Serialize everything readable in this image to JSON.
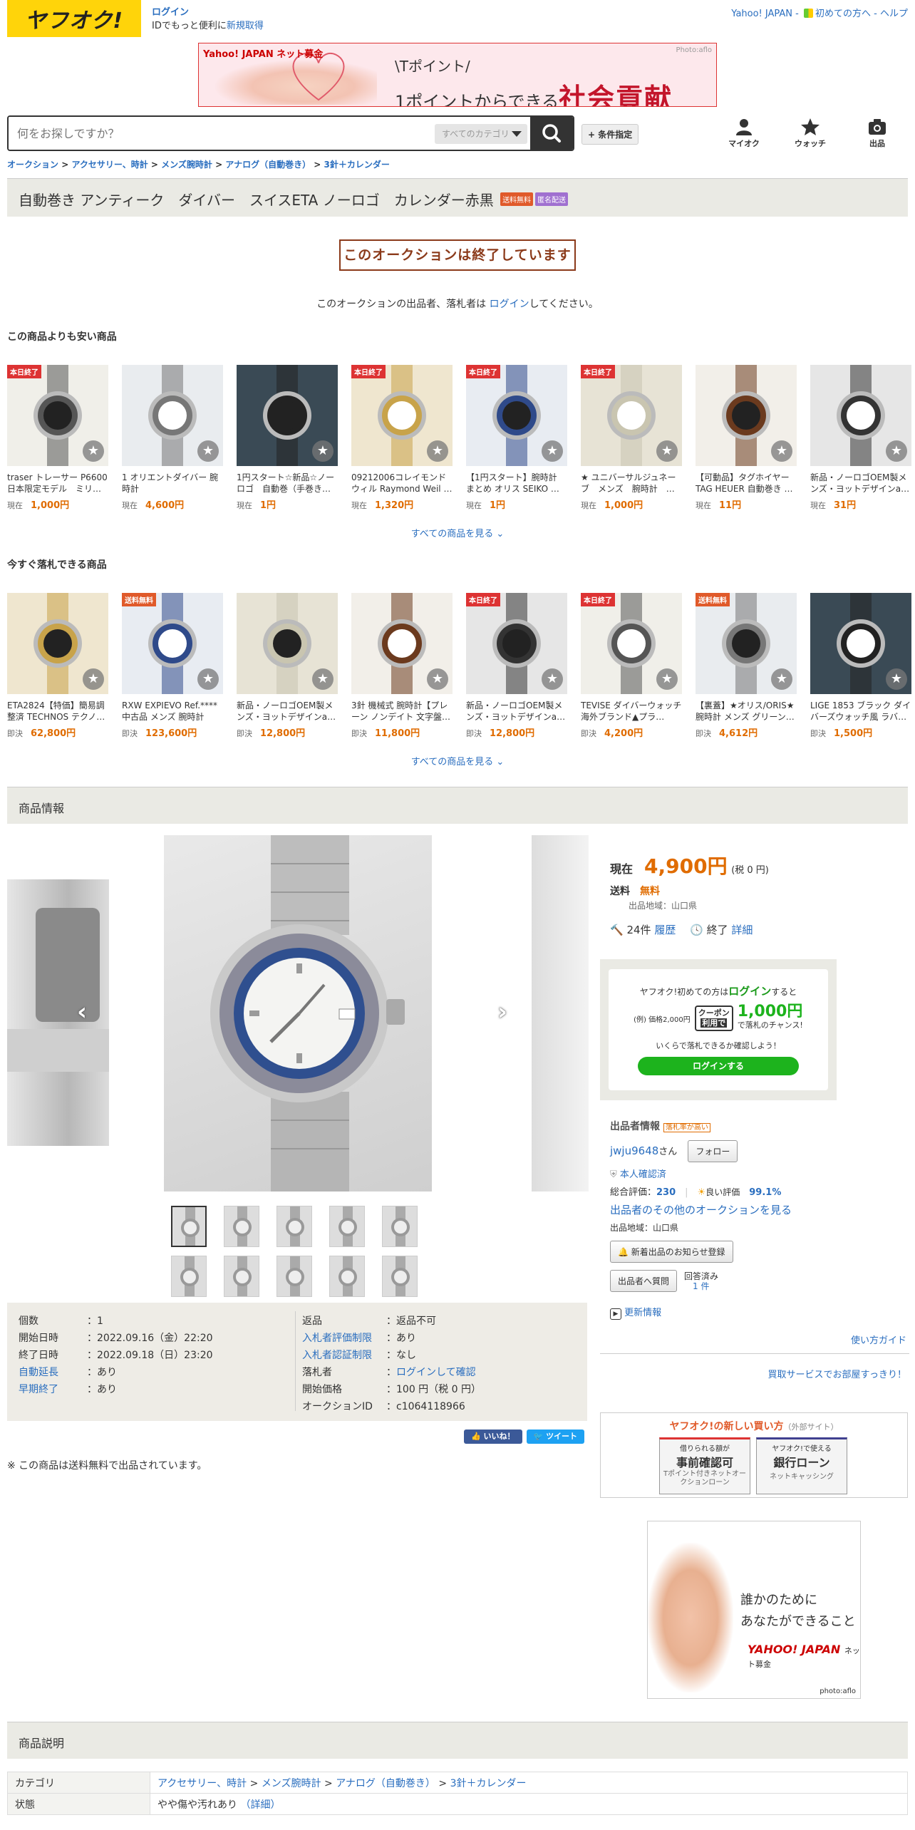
{
  "header": {
    "logo": "ヤフオク!",
    "login": "ログイン",
    "login_sub_prefix": "IDでもっと便利に",
    "signup": "新規取得",
    "yahoo_japan": "Yahoo! JAPAN",
    "beginners": "初めての方へ",
    "help": "ヘルプ",
    "sep1": " - ",
    "sep2": " - "
  },
  "banner": {
    "brand": "Yahoo! JAPAN ネット募金",
    "photo": "Photo:aflo",
    "line1": "\\Tポイント/",
    "line2": "1ポイントからできる",
    "line3": "社会貢献"
  },
  "search": {
    "placeholder": "何をお探しですか？",
    "category": "すべてのカテゴリ",
    "condition": "+ 条件指定"
  },
  "nav": {
    "mypage": "マイオク",
    "watch": "ウォッチ",
    "sell": "出品"
  },
  "breadcrumb": [
    "オークション",
    "アクセサリー、時計",
    "メンズ腕時計",
    "アナログ（自動巻き）",
    "3針＋カレンダー"
  ],
  "breadcrumb_sep": " > ",
  "title": "自動巻き アンティーク　ダイバー　スイスETA ノーロゴ　カレンダー赤黒",
  "badges": {
    "free_ship": "送料無料",
    "anonymous": "匿名配送"
  },
  "ended": {
    "message": "このオークションは終了しています",
    "note_pre": "このオークションの出品者、落札者は ",
    "note_link": "ログイン",
    "note_post": "してください。"
  },
  "cheaper": {
    "heading": "この商品よりも安い商品",
    "see_all": "すべての商品を見る",
    "items": [
      {
        "title": "traser トレーサー P6600 日本限定モデル　ミリ…",
        "label": "現在",
        "price": "1,000円",
        "ribbon": "本日終了"
      },
      {
        "title": "1 オリエントダイバー 腕時計",
        "label": "現在",
        "price": "4,600円",
        "ribbon": ""
      },
      {
        "title": "1円スタート☆新品☆ノーロゴ　自動巻（手巻き…",
        "label": "現在",
        "price": "1円",
        "ribbon": ""
      },
      {
        "title": "09212006コレイモンドウィル Raymond Weil …",
        "label": "現在",
        "price": "1,320円",
        "ribbon": "本日終了"
      },
      {
        "title": "【1円スタート】腕時計 まとめ オリス SEIKO …",
        "label": "現在",
        "price": "1円",
        "ribbon": "本日終了"
      },
      {
        "title": "★ ユニバーサルジュネーブ　メンズ　腕時計　…",
        "label": "現在",
        "price": "1,000円",
        "ribbon": "本日終了"
      },
      {
        "title": "【可動品】タグホイヤー TAG HEUER 自動巻き …",
        "label": "現在",
        "price": "11円",
        "ribbon": ""
      },
      {
        "title": "新品・ノーロゴOEM製メンズ・ヨットデザインa…",
        "label": "現在",
        "price": "31円",
        "ribbon": ""
      }
    ]
  },
  "buynow": {
    "heading": "今すぐ落札できる商品",
    "see_all": "すべての商品を見る",
    "items": [
      {
        "title": "ETA2824【特価】簡易調整済 TECHNOS テクノ…",
        "label": "即決",
        "price": "62,800円",
        "ribbon": ""
      },
      {
        "title": "RXW EXPIEVO Ref.**** 中古品 メンズ 腕時計",
        "label": "即決",
        "price": "123,600円",
        "ribbon": "送料無料"
      },
      {
        "title": "新品・ノーロゴOEM製メンズ・ヨットデザインa…",
        "label": "即決",
        "price": "12,800円",
        "ribbon": ""
      },
      {
        "title": "3針 機械式 腕時計【プレーン ノンデイト 文字盤…",
        "label": "即決",
        "price": "11,800円",
        "ribbon": ""
      },
      {
        "title": "新品・ノーロゴOEM製メンズ・ヨットデザインa…",
        "label": "即決",
        "price": "12,800円",
        "ribbon": "本日終了"
      },
      {
        "title": "TEVISE ダイバーウォッチ 海外ブランド▲プラ…",
        "label": "即決",
        "price": "4,200円",
        "ribbon": "本日終了"
      },
      {
        "title": "【裏蓋】★オリス/ORIS★腕時計 メンズ グリーン…",
        "label": "即決",
        "price": "4,612円",
        "ribbon": "送料無料"
      },
      {
        "title": "LIGE 1853 ブラック ダイバーズウォッチ風 ラバ…",
        "label": "即決",
        "price": "1,500円",
        "ribbon": ""
      }
    ]
  },
  "product_info": {
    "heading": "商品情報"
  },
  "specs": {
    "left": [
      {
        "k": "個数",
        "v": "1",
        "link": false
      },
      {
        "k": "開始日時",
        "v": "2022.09.16（金）22:20",
        "link": false
      },
      {
        "k": "終了日時",
        "v": "2022.09.18（日）23:20",
        "link": false
      },
      {
        "k": "自動延長",
        "v": "あり",
        "link": true
      },
      {
        "k": "早期終了",
        "v": "あり",
        "link": true
      }
    ],
    "right": [
      {
        "k": "返品",
        "v": "返品不可",
        "link": false
      },
      {
        "k": "入札者評価制限",
        "v": "あり",
        "link": true
      },
      {
        "k": "入札者認証制限",
        "v": "なし",
        "link": true
      },
      {
        "k": "落札者",
        "v": "ログインして確認",
        "link": false
      },
      {
        "k": "開始価格",
        "v": "100 円（税 0 円）",
        "link": false
      },
      {
        "k": "オークションID",
        "v": "c1064118966",
        "link": false
      }
    ]
  },
  "sns": {
    "like": "いいね！",
    "tweet": "ツイート"
  },
  "ship_note": "※ この商品は送料無料で出品されています。",
  "price": {
    "label": "現在",
    "value": "4,900円",
    "tax": "(税 0 円)",
    "ship_label": "送料",
    "ship_value": "無料",
    "origin": "出品地域：山口県",
    "bids": "24件",
    "history": "履歴",
    "status": "終了",
    "detail": "詳細"
  },
  "promo": {
    "line1_pre": "ヤフオク!初めての方は",
    "line1_link": "ログイン",
    "line1_post": "すると",
    "example": "(例) 価格2,000円",
    "coupon": "クーポン",
    "use": "利用で",
    "amount": "1,000円",
    "chance": "で落札のチャンス!",
    "check": "いくらで落札できるか確認しよう！",
    "button": "ログインする"
  },
  "seller": {
    "heading": "出品者情報",
    "rate_badge": "落札率が高い",
    "name": "jwju9648",
    "san": "さん",
    "follow": "フォロー",
    "verified": "本人確認済",
    "total_label": "総合評価：",
    "total": "230",
    "good_label": "良い評価",
    "good": "99.1%",
    "other": "出品者のその他のオークションを見る",
    "region": "出品地域：山口県",
    "notify": "新着出品のお知らせ登録",
    "ask": "出品者へ質問",
    "answered": "回答済み",
    "answered_count": "1 件",
    "update": "更新情報",
    "guide": "使い方ガイド",
    "purchase": "買取サービスでお部屋すっきり！"
  },
  "newbuy": {
    "title": "ヤフオク!の新しい買い方",
    "external": "（外部サイト）",
    "card1_top": "借りられる額が",
    "card1_main": "事前確認可",
    "card1_sub": "Tポイント付きネットオークションローン",
    "card2_top": "ヤフオク!で使える",
    "card2_main": "銀行ローン",
    "card2_sub": "ネットキャッシング"
  },
  "ad": {
    "line1": "誰かのために",
    "line2": "あなたができること",
    "brand": "YAHOO! JAPAN",
    "fund": "ネット募金",
    "photo": "photo:aflo"
  },
  "description": {
    "heading": "商品説明",
    "category_label": "カテゴリ",
    "category": [
      "アクセサリー、時計",
      "メンズ腕時計",
      "アナログ（自動巻き）",
      "3針＋カレンダー"
    ],
    "state_label": "状態",
    "state": "やや傷や汚れあり",
    "state_detail": "（詳細）"
  },
  "colors": {
    "accent": "#e06c00",
    "link": "#2a6ebf",
    "logo_bg": "#ffd40a",
    "ended": "#8b3a1a",
    "red": "#d33",
    "green": "#1db31d"
  }
}
